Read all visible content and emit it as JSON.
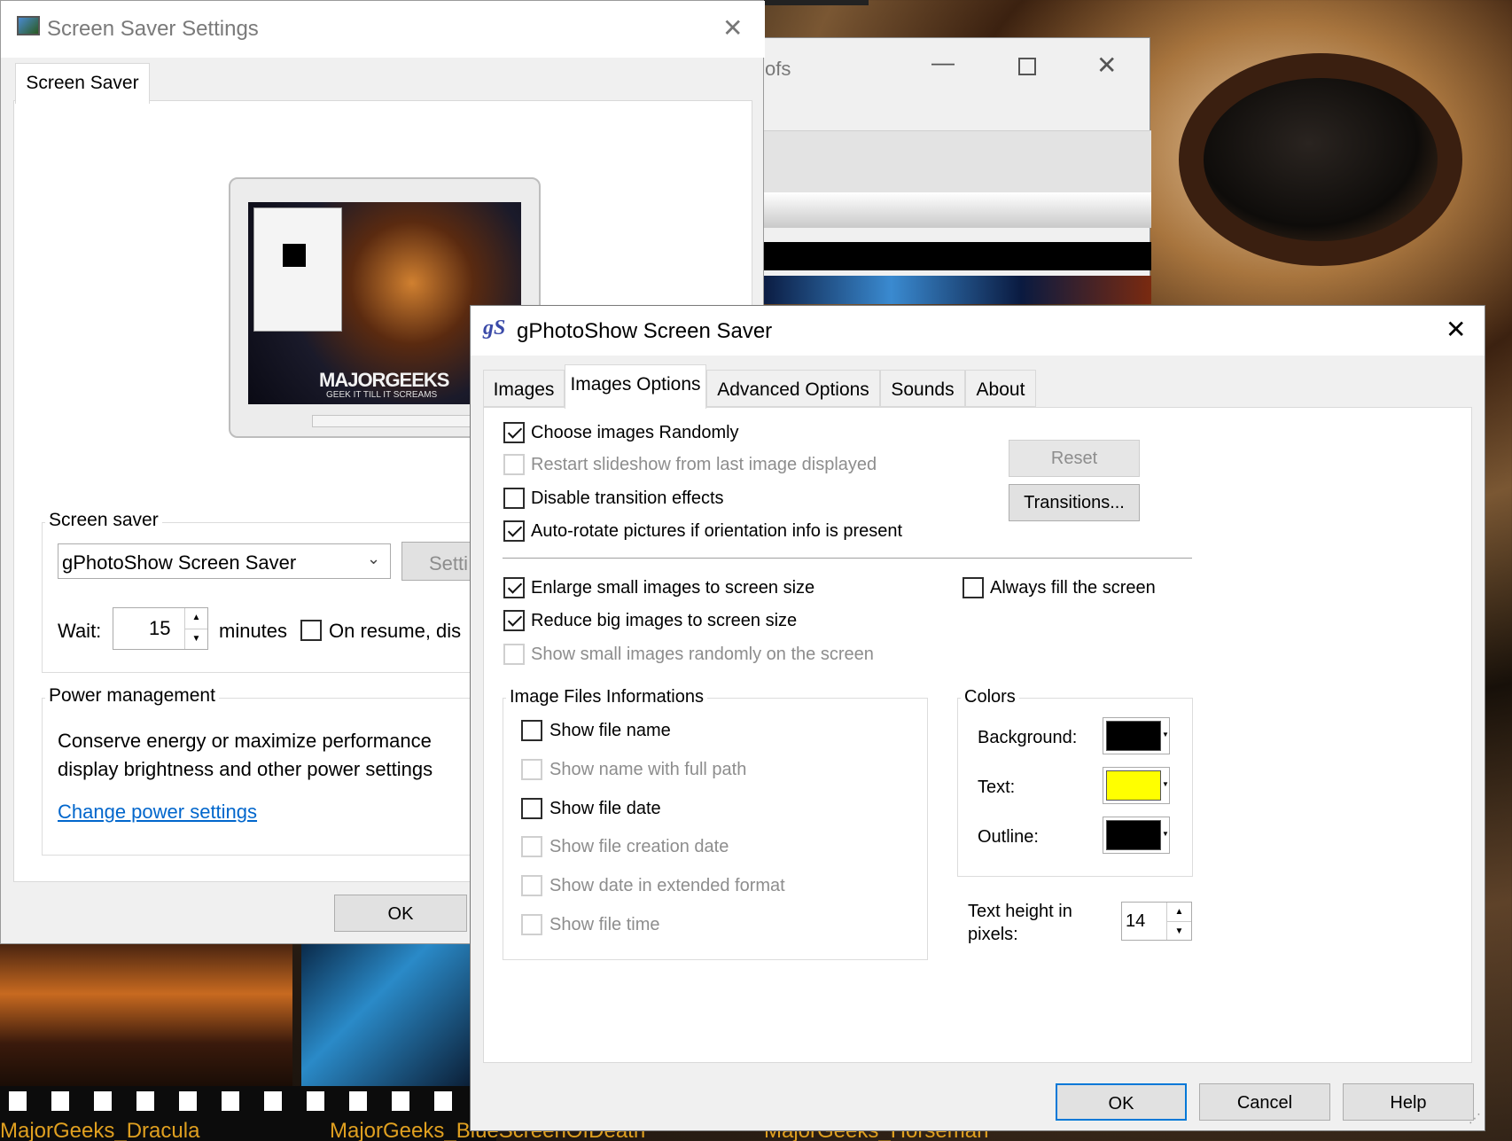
{
  "wallpaper": {
    "captions": [
      "MajorGeeks_Dracula",
      "MajorGeeks_BlueScreenOfDeath",
      "MajorGeeks_Horseman"
    ],
    "caption_color": "#e0a020"
  },
  "background_window": {
    "title_fragment": "ofs"
  },
  "ss_dialog": {
    "title": "Screen Saver Settings",
    "tab": "Screen Saver",
    "preview_text": "MAJORGEEKS",
    "preview_subtext": "GEEK IT TILL IT SCREAMS",
    "group_label": "Screen saver",
    "selected_saver": "gPhotoShow Screen Saver",
    "settings_button": "Setti",
    "wait_label": "Wait:",
    "wait_value": "15",
    "minutes_label": "minutes",
    "resume_label": "On resume, dis",
    "power_group": "Power management",
    "power_text_1": "Conserve energy or maximize performance",
    "power_text_2": "display brightness and other power settings",
    "power_link": "Change power settings",
    "ok_button": "OK"
  },
  "gps_dialog": {
    "title": "gPhotoShow Screen Saver",
    "app_icon": "gS",
    "tabs": [
      "Images",
      "Images Options",
      "Advanced Options",
      "Sounds",
      "About"
    ],
    "active_tab": "Images Options",
    "options": {
      "choose_random": "Choose images Randomly",
      "restart_last": "Restart slideshow from last image displayed",
      "disable_transition": "Disable transition effects",
      "auto_rotate": "Auto-rotate pictures if orientation info is present",
      "enlarge_small": "Enlarge small images to screen size",
      "reduce_big": "Reduce big images to screen size",
      "show_small_random": "Show small images randomly on the screen",
      "always_fill": "Always fill the screen"
    },
    "reset_button": "Reset",
    "transitions_button": "Transitions...",
    "info_group": {
      "label": "Image Files Informations",
      "show_file_name": "Show file name",
      "show_full_path": "Show name with full path",
      "show_file_date": "Show file date",
      "show_creation_date": "Show file creation date",
      "show_extended_date": "Show date in extended format",
      "show_file_time": "Show file time"
    },
    "colors": {
      "label": "Colors",
      "background_label": "Background:",
      "background_value": "#000000",
      "text_label": "Text:",
      "text_value": "#ffff00",
      "outline_label": "Outline:",
      "outline_value": "#000000"
    },
    "text_height_label_1": "Text height in",
    "text_height_label_2": "pixels:",
    "text_height_value": "14",
    "ok_button": "OK",
    "cancel_button": "Cancel",
    "help_button": "Help"
  }
}
